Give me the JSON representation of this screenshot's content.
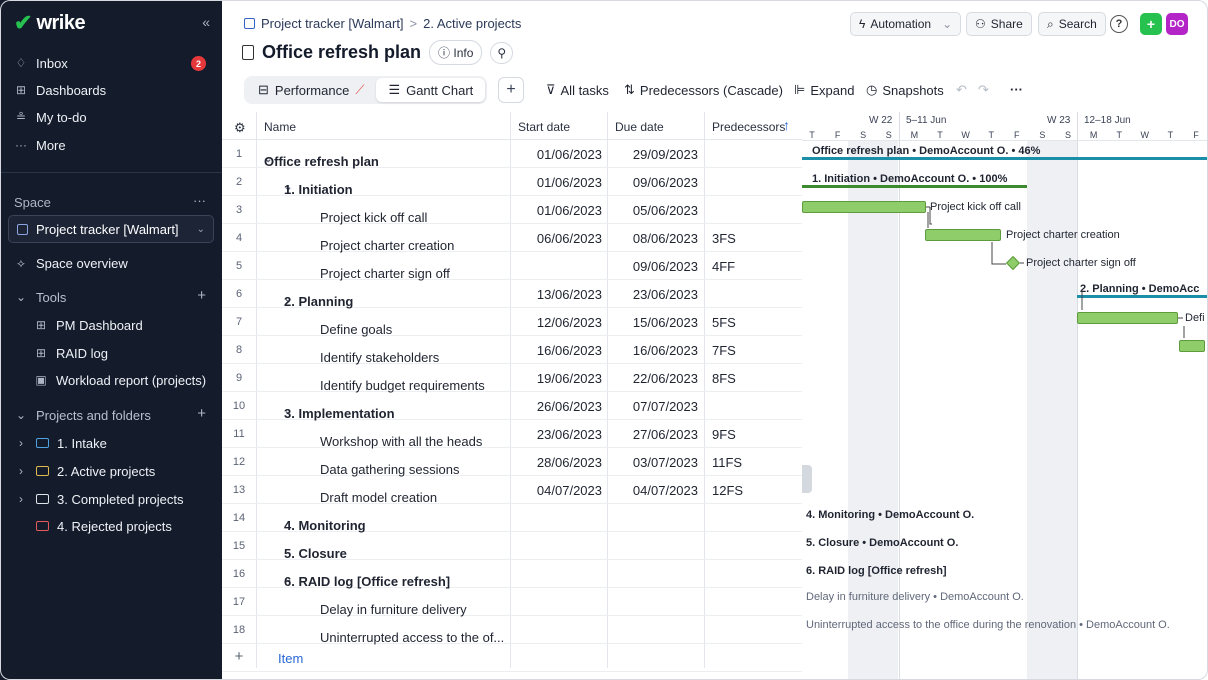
{
  "sidebar": {
    "logo": "wrike",
    "collapse_icon": "«",
    "nav": [
      {
        "label": "Inbox",
        "icon": "bell-icon",
        "badge": "2"
      },
      {
        "label": "Dashboards",
        "icon": "dashboard-icon"
      },
      {
        "label": "My to-do",
        "icon": "todo-icon"
      },
      {
        "label": "More",
        "icon": "more-icon"
      }
    ],
    "space_section": "Space",
    "space_more": "···",
    "space_selected": "Project tracker [Walmart]",
    "space_overview": "Space overview",
    "tools_label": "Tools",
    "tools": [
      "PM Dashboard",
      "RAID log",
      "Workload report (projects)"
    ],
    "projects_label": "Projects and folders",
    "folders": [
      {
        "label": "1. Intake",
        "color": "#4fa3e0"
      },
      {
        "label": "2. Active projects",
        "color": "#e0b94f"
      },
      {
        "label": "3. Completed projects",
        "color": "#dfe3ea"
      },
      {
        "label": "4. Rejected projects",
        "color": "#e25a5a"
      }
    ]
  },
  "header": {
    "breadcrumb_space": "Project tracker [Walmart]",
    "breadcrumb_sep": ">",
    "breadcrumb_folder": "2. Active projects",
    "title": "Office refresh plan",
    "info_label": "ⓘ Info",
    "automation": "Automation",
    "share": "Share",
    "search": "Search",
    "help": "?",
    "add": "+",
    "avatar": "DO"
  },
  "toolbar": {
    "tabs": [
      "Performance",
      "Gantt Chart"
    ],
    "add": "+",
    "all_tasks": "All tasks",
    "predecessors": "Predecessors (Cascade)",
    "expand": "Expand",
    "snapshots": "Snapshots",
    "more": "···"
  },
  "table": {
    "columns": [
      "Name",
      "Start date",
      "Due date",
      "Predecessors"
    ],
    "rows": [
      {
        "n": "1",
        "name": "Office refresh plan",
        "start": "01/06/2023",
        "due": "29/09/2023",
        "pred": "",
        "level": 0,
        "bold": true,
        "caret": "⌄"
      },
      {
        "n": "2",
        "name": "1. Initiation",
        "start": "01/06/2023",
        "due": "09/06/2023",
        "pred": "",
        "level": 1,
        "bold": true,
        "caret": "⌄"
      },
      {
        "n": "3",
        "name": "Project kick off call",
        "start": "01/06/2023",
        "due": "05/06/2023",
        "pred": "",
        "level": 2,
        "bold": false
      },
      {
        "n": "4",
        "name": "Project charter creation",
        "start": "06/06/2023",
        "due": "08/06/2023",
        "pred": "3FS",
        "level": 2,
        "bold": false
      },
      {
        "n": "5",
        "name": "Project charter sign off",
        "start": "",
        "due": "09/06/2023",
        "pred": "4FF",
        "level": 2,
        "bold": false
      },
      {
        "n": "6",
        "name": "2. Planning",
        "start": "13/06/2023",
        "due": "23/06/2023",
        "pred": "",
        "level": 1,
        "bold": true,
        "caret": "⌄"
      },
      {
        "n": "7",
        "name": "Define goals",
        "start": "12/06/2023",
        "due": "15/06/2023",
        "pred": "5FS",
        "level": 2,
        "bold": false
      },
      {
        "n": "8",
        "name": "Identify stakeholders",
        "start": "16/06/2023",
        "due": "16/06/2023",
        "pred": "7FS",
        "level": 2,
        "bold": false
      },
      {
        "n": "9",
        "name": "Identify budget requirements",
        "start": "19/06/2023",
        "due": "22/06/2023",
        "pred": "8FS",
        "level": 2,
        "bold": false
      },
      {
        "n": "10",
        "name": "3. Implementation",
        "start": "26/06/2023",
        "due": "07/07/2023",
        "pred": "",
        "level": 1,
        "bold": true,
        "caret": "⌄"
      },
      {
        "n": "11",
        "name": "Workshop with all the heads",
        "start": "23/06/2023",
        "due": "27/06/2023",
        "pred": "9FS",
        "level": 2,
        "bold": false
      },
      {
        "n": "12",
        "name": "Data gathering sessions",
        "start": "28/06/2023",
        "due": "03/07/2023",
        "pred": "11FS",
        "level": 2,
        "bold": false
      },
      {
        "n": "13",
        "name": "Draft model creation",
        "start": "04/07/2023",
        "due": "04/07/2023",
        "pred": "12FS",
        "level": 2,
        "bold": false
      },
      {
        "n": "14",
        "name": "4. Monitoring",
        "start": "",
        "due": "",
        "pred": "",
        "level": 1,
        "bold": true
      },
      {
        "n": "15",
        "name": "5. Closure",
        "start": "",
        "due": "",
        "pred": "",
        "level": 1,
        "bold": true
      },
      {
        "n": "16",
        "name": "6. RAID log [Office refresh]",
        "start": "",
        "due": "",
        "pred": "",
        "level": 1,
        "bold": true,
        "caret": "⌄"
      },
      {
        "n": "17",
        "name": "Delay in furniture delivery",
        "start": "",
        "due": "",
        "pred": "",
        "level": 2,
        "bold": false
      },
      {
        "n": "18",
        "name": "Uninterrupted access to the of...",
        "start": "",
        "due": "",
        "pred": "",
        "level": 2,
        "bold": false
      }
    ],
    "add_row_icon": "+",
    "add_row_label": "Item"
  },
  "gantt": {
    "weeks": [
      {
        "label": "W 22"
      },
      {
        "label": "5–11 Jun"
      },
      {
        "label": "W 23"
      },
      {
        "label": "12–18 Jun"
      }
    ],
    "days": [
      "T",
      "F",
      "S",
      "S",
      "M",
      "T",
      "W",
      "T",
      "F",
      "S",
      "S",
      "M",
      "T",
      "W",
      "T",
      "F"
    ],
    "labels": {
      "root": "Office refresh plan • DemoAccount O. • 46%",
      "initiation": "1. Initiation • DemoAccount O. • 100%",
      "kickoff": "Project kick off call",
      "charter": "Project charter creation",
      "signoff": "Project charter sign off",
      "planning": "2. Planning • DemoAcc",
      "define": "Defi",
      "monitoring": "4. Monitoring • DemoAccount O.",
      "closure": "5. Closure • DemoAccount O.",
      "raid": "6. RAID log [Office refresh]",
      "delay": "Delay in furniture delivery • DemoAccount O.",
      "access": "Uninterrupted access to the office during the renovation • DemoAccount O."
    },
    "colors": {
      "bar": "#8fcd6a",
      "root_line": "#1b8fa8",
      "summary_line": "#3b8a2e"
    }
  }
}
